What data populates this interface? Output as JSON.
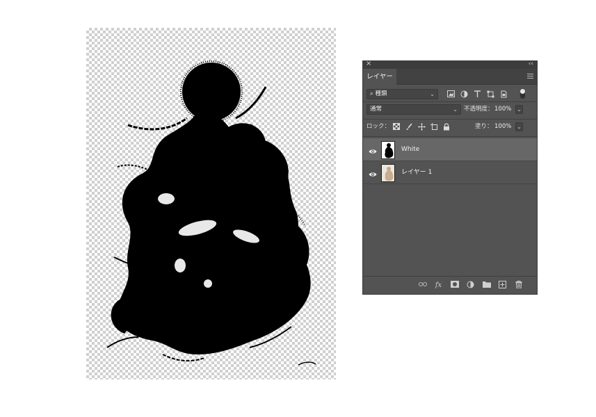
{
  "panel": {
    "close_glyph": "×",
    "collapse_glyph": "‹‹",
    "tab_label": "レイヤー",
    "filter": {
      "selected": "種類",
      "search_glyph": "⌕"
    },
    "blend_mode": "通常",
    "opacity_label": "不透明度：",
    "opacity_value": "100%",
    "lock_label": "ロック：",
    "fill_label": "塗り：",
    "fill_value": "100%",
    "layers": [
      {
        "name": "White",
        "visible": true,
        "selected": true
      },
      {
        "name": "レイヤー 1",
        "visible": true,
        "selected": false
      }
    ]
  },
  "colors": {
    "panel_bg": "#535353",
    "selected_layer_bg": "#676767",
    "checker": "#cfcfcf",
    "silhouette": "#000000"
  },
  "icons": {
    "filter_icons": [
      "image-filter-icon",
      "adjustment-filter-icon",
      "type-filter-icon",
      "shape-filter-icon",
      "smart-object-filter-icon"
    ],
    "lock_icons": [
      "lock-transparent-pixels-icon",
      "lock-image-pixels-icon",
      "lock-position-icon",
      "lock-artboard-icon",
      "lock-all-icon"
    ],
    "bottom_icons": [
      "link-layers-icon",
      "fx-icon",
      "add-mask-icon",
      "adjustment-layer-icon",
      "new-group-icon",
      "new-layer-icon",
      "delete-layer-icon"
    ]
  }
}
